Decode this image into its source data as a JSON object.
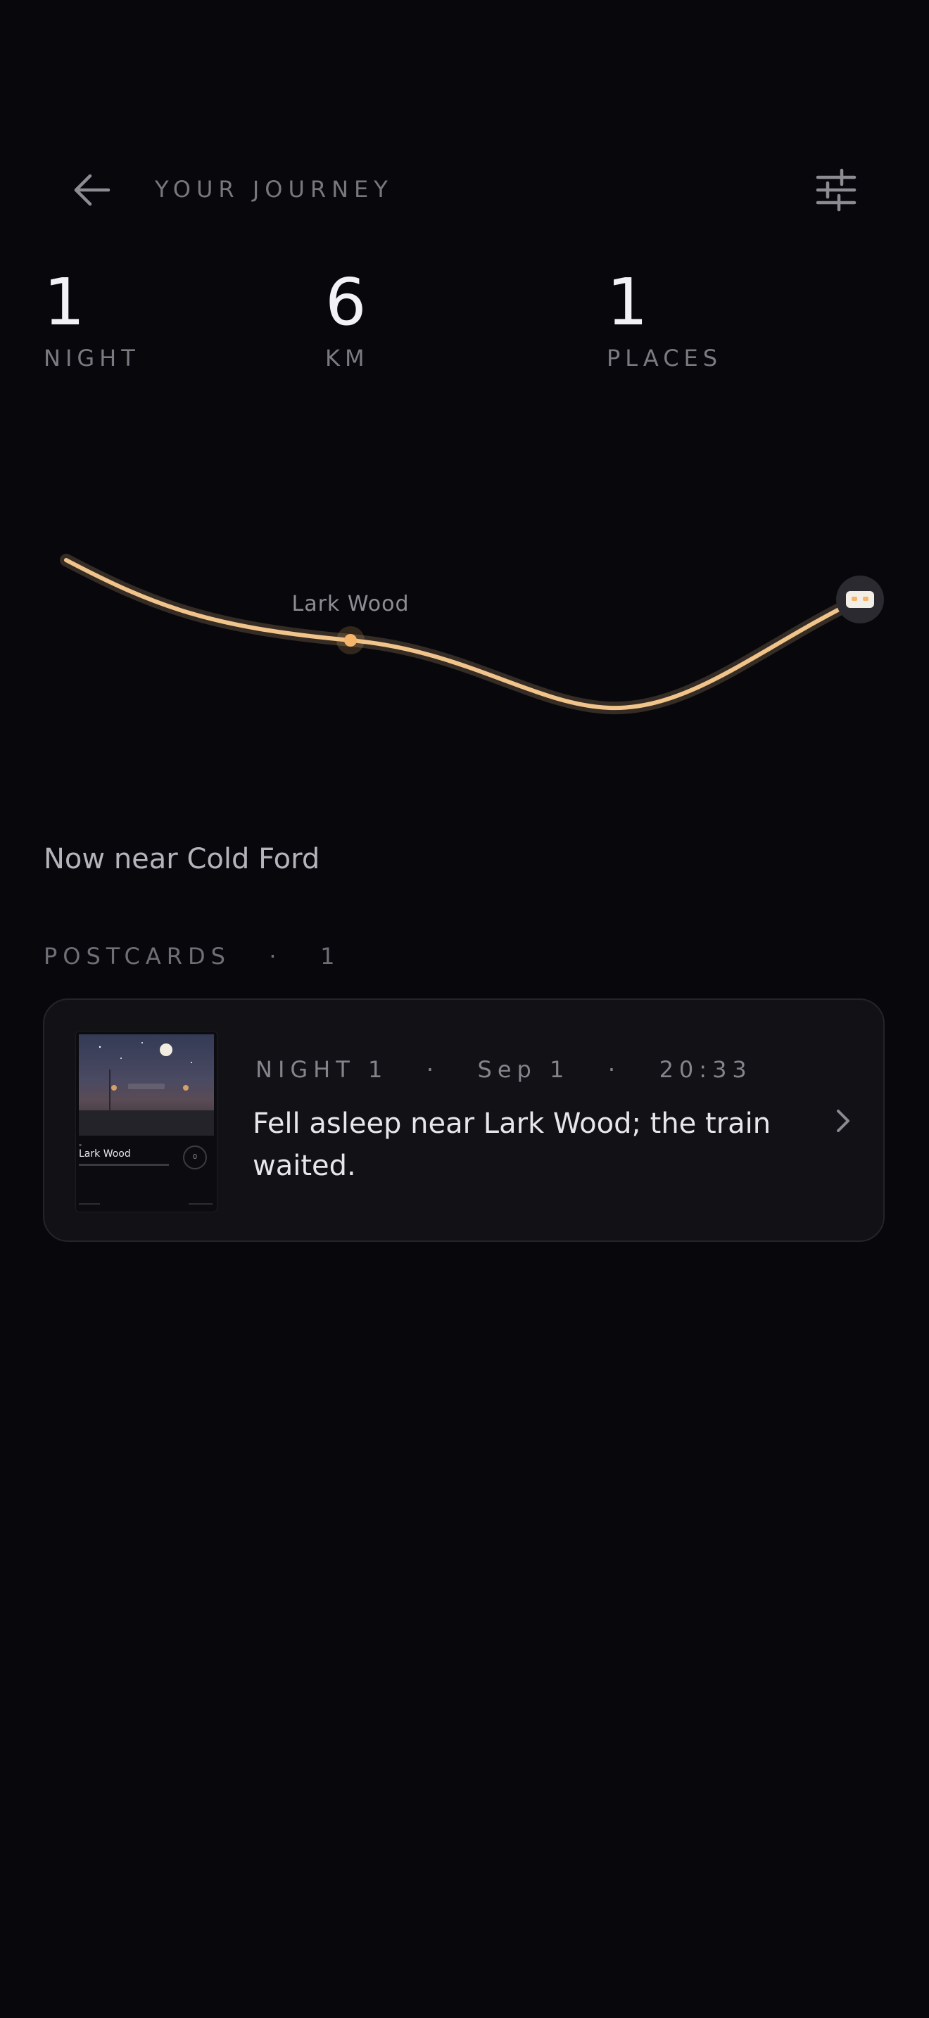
{
  "header": {
    "title": "YOUR JOURNEY",
    "back_icon": "arrow-left-icon",
    "filter_icon": "sliders-icon"
  },
  "stats": [
    {
      "value": "1",
      "label": "NIGHT"
    },
    {
      "value": "6",
      "label": "KM"
    },
    {
      "value": "1",
      "label": "PLACES"
    }
  ],
  "route": {
    "place_label": "Lark Wood",
    "line_color": "#f0c48a",
    "marker_color": "#f5b56a"
  },
  "status": "Now near Cold Ford",
  "postcards": {
    "section_label": "POSTCARDS",
    "separator": "·",
    "count": "1",
    "items": [
      {
        "meta_night": "NIGHT 1",
        "meta_date": "Sep 1",
        "meta_time": "20:33",
        "meta_sep": "·",
        "caption": "Fell asleep near Lark Wood; the train waited.",
        "thumb_title": "Lark Wood",
        "thumb_stamp": "0"
      }
    ]
  },
  "colors": {
    "background": "#08080c",
    "card": "#111116",
    "accent": "#f0c48a"
  }
}
